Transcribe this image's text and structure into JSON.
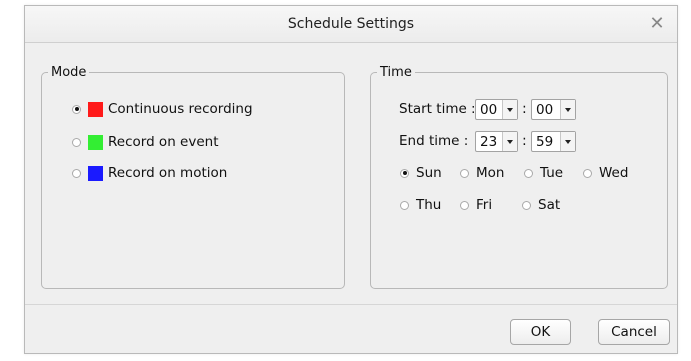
{
  "dialog": {
    "title": "Schedule Settings",
    "close_icon": "close-x-icon"
  },
  "mode": {
    "legend": "Mode",
    "options": [
      {
        "label": "Continuous recording",
        "color": "#ff1a1a",
        "checked": true
      },
      {
        "label": "Record on event",
        "color": "#33ee33",
        "checked": false
      },
      {
        "label": "Record on motion",
        "color": "#1a1aff",
        "checked": false
      }
    ]
  },
  "time": {
    "legend": "Time",
    "start_label": "Start time :",
    "start_hour": "00",
    "start_minute": "00",
    "end_label": "End time :",
    "end_hour": "23",
    "end_minute": "59",
    "colon": ":",
    "days": [
      {
        "label": "Sun",
        "checked": true
      },
      {
        "label": "Mon",
        "checked": false
      },
      {
        "label": "Tue",
        "checked": false
      },
      {
        "label": "Wed",
        "checked": false
      },
      {
        "label": "Thu",
        "checked": false
      },
      {
        "label": "Fri",
        "checked": false
      },
      {
        "label": "Sat",
        "checked": false
      }
    ]
  },
  "footer": {
    "ok_label": "OK",
    "cancel_label": "Cancel"
  }
}
